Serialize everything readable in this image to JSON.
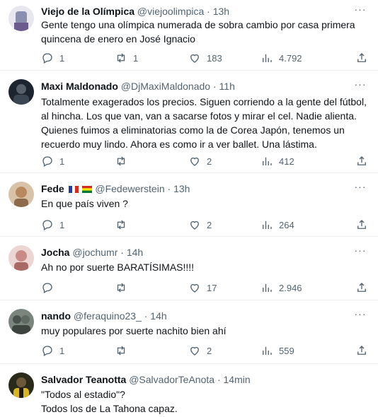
{
  "tweets": [
    {
      "name": "Viejo de la Olímpica",
      "handle": "@viejoolimpica",
      "time": "13h",
      "text": "Gente tengo una olímpica numerada de sobra cambio por casa primera quincena de enero en José Ignacio",
      "replies": "1",
      "retweets": "1",
      "likes": "183",
      "views": "4.792",
      "avatar_color": "#8a8fb0"
    },
    {
      "name": "Maxi Maldonado",
      "handle": "@DjMaxiMaldonado",
      "time": "11h",
      "text": "Totalmente exagerados los precios. Siguen corriendo a la gente del fútbol, al hincha. Los que van, van a sacarse fotos y mirar el cel. Nadie alienta. Quienes fuimos a eliminatorias como la de Corea Japón, tenemos un recuerdo muy lindo. Ahora es como ir a ver ballet. Una lástima.",
      "replies": "1",
      "retweets": "",
      "likes": "2",
      "views": "412",
      "avatar_color": "#2f3a45"
    },
    {
      "name": "Fede",
      "handle": "@Fedewerstein",
      "time": "13h",
      "text": "En que país viven ?",
      "replies": "1",
      "retweets": "",
      "likes": "2",
      "views": "264",
      "avatar_color": "#b8895e"
    },
    {
      "name": "Jocha",
      "handle": "@jochumr",
      "time": "14h",
      "text": "Ah no por suerte BARATÍSIMAS!!!!",
      "replies": "",
      "retweets": "",
      "likes": "17",
      "views": "2.946",
      "avatar_color": "#c98b86"
    },
    {
      "name": "nando",
      "handle": "@feraquino23_",
      "time": "14h",
      "text": "muy populares por suerte nachito bien ahí",
      "replies": "1",
      "retweets": "",
      "likes": "2",
      "views": "559",
      "avatar_color": "#5f6a63"
    },
    {
      "name": "Salvador Teanotta",
      "handle": "@SalvadorTeAnota",
      "time": "14min",
      "text_lines": [
        "\"Todos al estadio\"?",
        "Todos los de La Tahona capaz."
      ],
      "avatar_color": "#3b3a1f"
    }
  ],
  "ui": {
    "dot": "·",
    "more": "···",
    "icons": [
      "reply-icon",
      "retweet-icon",
      "like-icon",
      "views-icon",
      "share-icon",
      "more-icon"
    ],
    "icon_color": "#536471",
    "separator_color": "#eff3f4"
  }
}
